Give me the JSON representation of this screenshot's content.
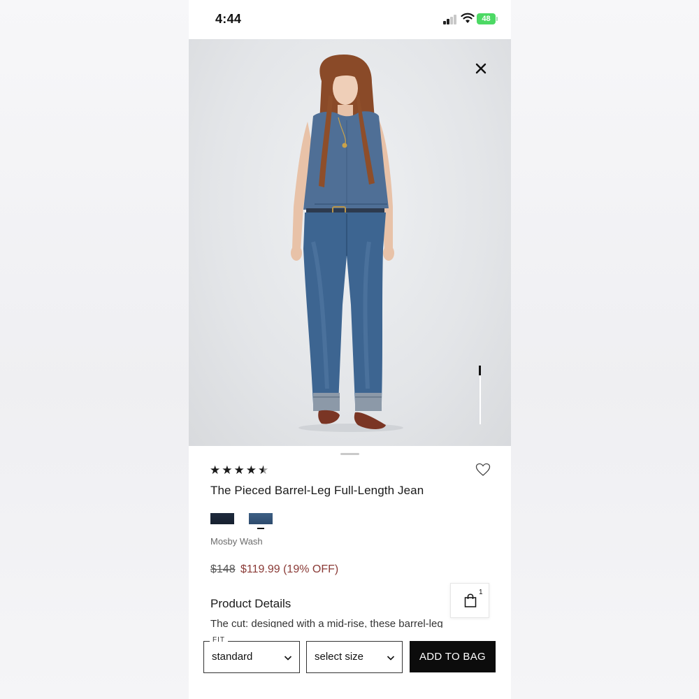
{
  "status_bar": {
    "time": "4:44",
    "battery": "48"
  },
  "product": {
    "image_icon": "model-wearing-jeans-photo",
    "rating_stars": [
      "★",
      "★",
      "★",
      "★",
      "★"
    ],
    "rating_value": 4.5,
    "title": "The Pieced Barrel-Leg Full-Length Jean",
    "swatches": [
      {
        "color": "#1e2a3d"
      },
      {
        "color": "#3d5f84"
      }
    ],
    "color_name": "Mosby Wash",
    "price_original": "$148",
    "price_sale": "$119.99 (19% OFF)",
    "details_heading": "Product Details",
    "details_text": "The cut: designed with a mid-rise, these barrel-leg"
  },
  "bag": {
    "count": "1"
  },
  "bottom_bar": {
    "fit_label": "FIT",
    "fit_value": "standard",
    "size_value": "select size",
    "add_to_bag": "ADD TO BAG"
  },
  "colors": {
    "sale_price": "#8a3a36",
    "button_bg": "#0c0c0c",
    "battery": "#4cd964"
  }
}
